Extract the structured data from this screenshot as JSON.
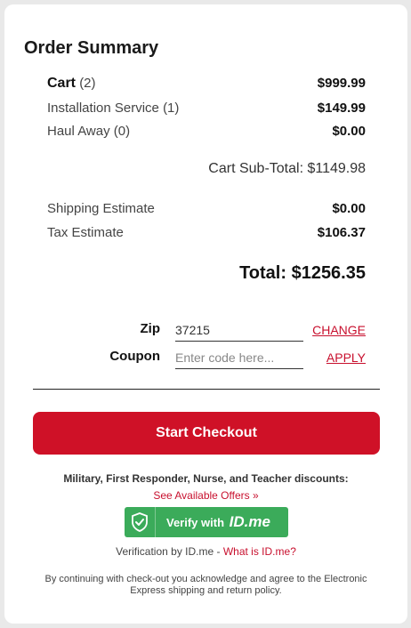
{
  "summary": {
    "title": "Order Summary",
    "cart_label": "Cart",
    "cart_count": "(2)",
    "cart_amount": "$999.99",
    "installation_label": "Installation Service (1)",
    "installation_amount": "$149.99",
    "haul_label": "Haul Away (0)",
    "haul_amount": "$0.00",
    "subtotal": "Cart Sub-Total: $1149.98",
    "shipping_label": "Shipping Estimate",
    "shipping_amount": "$0.00",
    "tax_label": "Tax Estimate",
    "tax_amount": "$106.37",
    "total": "Total: $1256.35"
  },
  "form": {
    "zip_label": "Zip",
    "zip_value": "37215",
    "change_link": "CHANGE",
    "coupon_label": "Coupon",
    "coupon_placeholder": "Enter code here...",
    "apply_link": "APPLY"
  },
  "checkout": {
    "button_label": "Start Checkout"
  },
  "discounts": {
    "heading": "Military, First Responder, Nurse, and Teacher discounts:",
    "offers_link": "See Available Offers »",
    "idme_button_text": "Verify with",
    "idme_brand": "ID.me",
    "verification_text": "Verification by ID.me - ",
    "what_link": "What is ID.me?"
  },
  "disclaimer": "By continuing with check-out you acknowledge and agree to the Electronic Express shipping and return policy.",
  "colors": {
    "accent_red": "#cf1127",
    "idme_green": "#3bab5a"
  },
  "icons": {
    "idme": "shield-check-icon"
  }
}
